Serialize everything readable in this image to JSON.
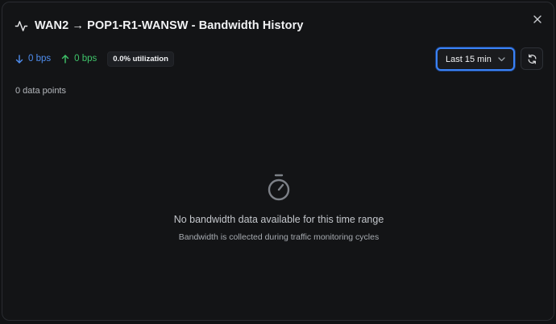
{
  "dialog": {
    "title": "WAN2 → POP1-R1-WANSW - Bandwidth History",
    "title_icon": "activity-pulse-icon",
    "close_icon": "close-icon"
  },
  "stats": {
    "download": "0 bps",
    "upload": "0 bps",
    "utilization": "0.0% utilization",
    "download_color": "#4f8ef0",
    "upload_color": "#3fc46a"
  },
  "controls": {
    "time_range": "Last 15 min",
    "refresh_icon": "refresh-icon"
  },
  "data_points": "0 data points",
  "empty_state": {
    "icon": "timer-icon",
    "title": "No bandwidth data available for this time range",
    "subtitle": "Bandwidth is collected during traffic monitoring cycles"
  },
  "colors": {
    "accent": "#3b82f6",
    "background": "#131416"
  }
}
